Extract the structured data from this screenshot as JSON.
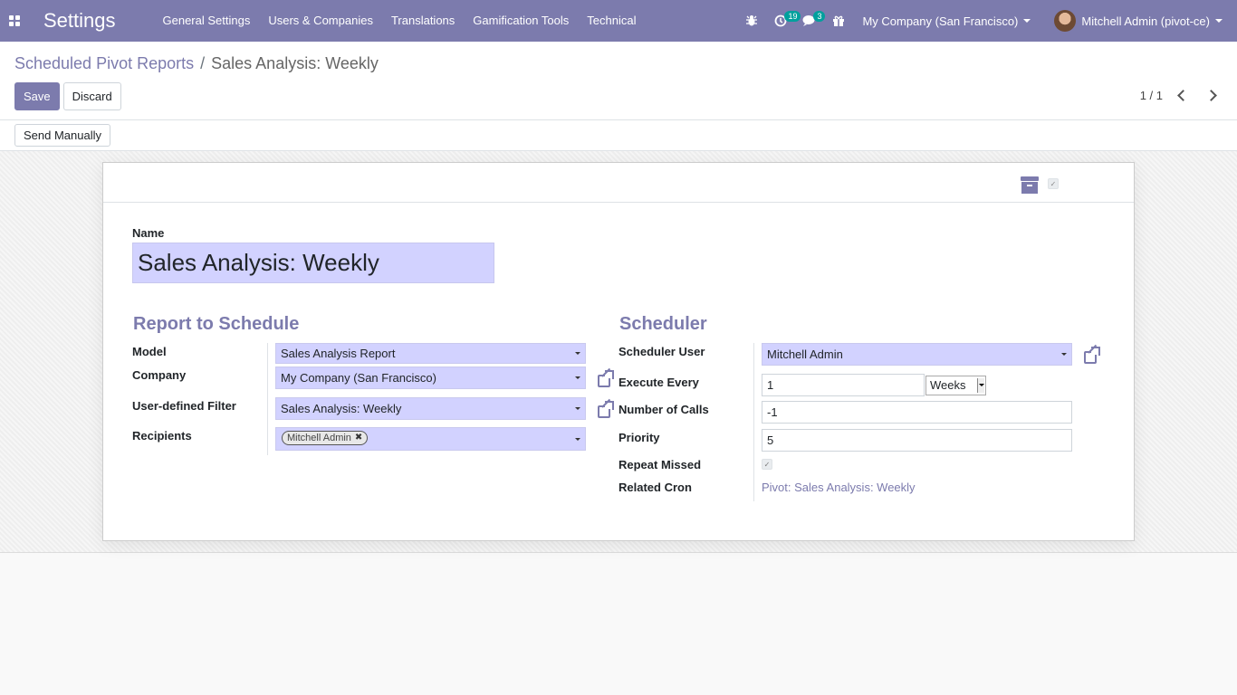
{
  "navbar": {
    "brand": "Settings",
    "menu": [
      "General Settings",
      "Users & Companies",
      "Translations",
      "Gamification Tools",
      "Technical"
    ],
    "activity_count": "19",
    "message_count": "3",
    "company": "My Company (San Francisco)",
    "user": "Mitchell Admin (pivot-ce)"
  },
  "breadcrumb": {
    "parent": "Scheduled Pivot Reports",
    "separator": "/",
    "current": "Sales Analysis: Weekly"
  },
  "control": {
    "save": "Save",
    "discard": "Discard",
    "pager": "1 / 1"
  },
  "statusbar": {
    "send_manually": "Send Manually"
  },
  "form": {
    "name_label": "Name",
    "name_value": "Sales Analysis: Weekly",
    "report_section": {
      "title": "Report to Schedule",
      "model_label": "Model",
      "model_value": "Sales Analysis Report",
      "company_label": "Company",
      "company_value": "My Company (San Francisco)",
      "filter_label": "User-defined Filter",
      "filter_value": "Sales Analysis: Weekly",
      "recipients_label": "Recipients",
      "recipient_tag": "Mitchell Admin"
    },
    "scheduler_section": {
      "title": "Scheduler",
      "user_label": "Scheduler User",
      "user_value": "Mitchell Admin",
      "execute_label": "Execute Every",
      "execute_value": "1",
      "execute_unit": "Weeks",
      "calls_label": "Number of Calls",
      "calls_value": "-1",
      "priority_label": "Priority",
      "priority_value": "5",
      "repeat_label": "Repeat Missed",
      "cron_label": "Related Cron",
      "cron_value": "Pivot: Sales Analysis: Weekly"
    }
  },
  "colors": {
    "brand": "#7c7bad",
    "required_field": "#d2d2ff",
    "badge": "#00a09d"
  }
}
